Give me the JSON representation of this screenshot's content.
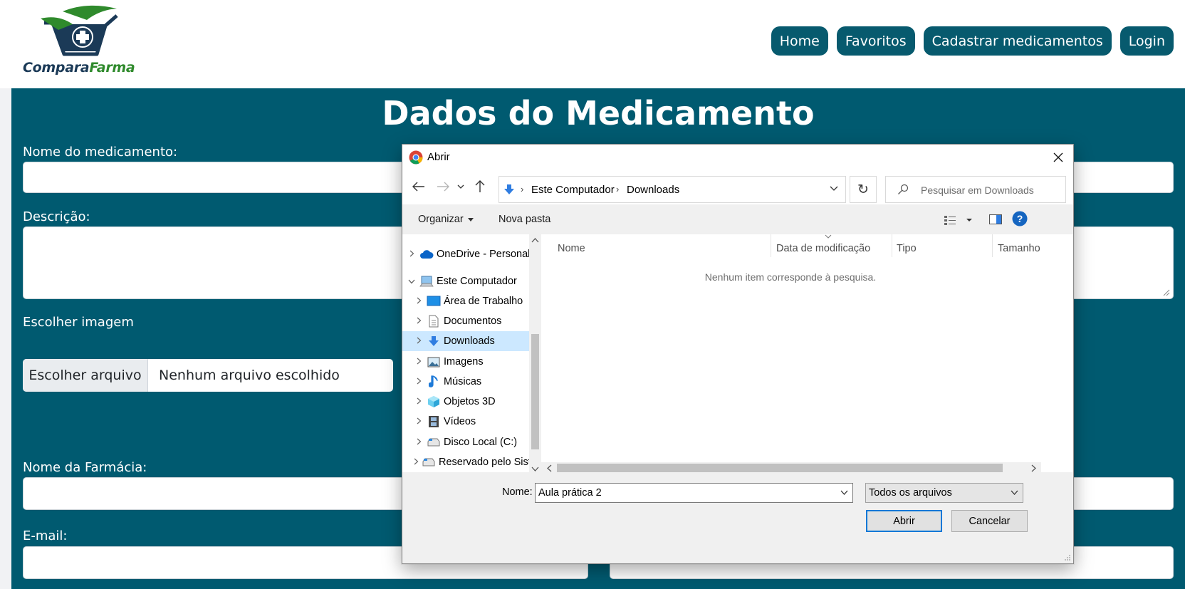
{
  "header": {
    "logo": {
      "part1": "Compara",
      "part2": "Farma"
    },
    "nav": [
      "Home",
      "Favoritos",
      "Cadastrar medicamentos",
      "Login"
    ]
  },
  "form": {
    "title": "Dados do Medicamento",
    "labels": {
      "nome": "Nome do medicamento:",
      "descricao": "Descrição:",
      "imagem": "Escolher imagem",
      "farmacia": "Nome da Farmácia:",
      "email": "E-mail:"
    },
    "file_button": "Escolher arquivo",
    "file_status": "Nenhum arquivo escolhido"
  },
  "dialog": {
    "title": "Abrir",
    "breadcrumb": [
      "Este Computador",
      "Downloads"
    ],
    "search_placeholder": "Pesquisar em Downloads",
    "commands": {
      "organize": "Organizar",
      "new_folder": "Nova pasta"
    },
    "tree": [
      {
        "label": "OneDrive - Personal",
        "icon": "cloud-icon",
        "level": 0,
        "expanded": false
      },
      {
        "label": "Este Computador",
        "icon": "computer-icon",
        "level": 0,
        "expanded": true
      },
      {
        "label": "Área de Trabalho",
        "icon": "desktop-icon",
        "level": 1,
        "expanded": false
      },
      {
        "label": "Documentos",
        "icon": "document-icon",
        "level": 1,
        "expanded": false
      },
      {
        "label": "Downloads",
        "icon": "download-icon",
        "level": 1,
        "expanded": false,
        "selected": true
      },
      {
        "label": "Imagens",
        "icon": "image-icon",
        "level": 1,
        "expanded": false
      },
      {
        "label": "Músicas",
        "icon": "music-icon",
        "level": 1,
        "expanded": false
      },
      {
        "label": "Objetos 3D",
        "icon": "cube-icon",
        "level": 1,
        "expanded": false
      },
      {
        "label": "Vídeos",
        "icon": "video-icon",
        "level": 1,
        "expanded": false
      },
      {
        "label": "Disco Local (C:)",
        "icon": "drive-icon",
        "level": 1,
        "expanded": false
      },
      {
        "label": "Reservado pelo Sistema",
        "icon": "drive-icon",
        "level": 1,
        "expanded": false
      }
    ],
    "columns": [
      "Nome",
      "Data de modificação",
      "Tipo",
      "Tamanho"
    ],
    "empty_message": "Nenhum item corresponde à pesquisa.",
    "filename_label": "Nome:",
    "filename_value": "Aula prática 2",
    "filetype": "Todos os arquivos",
    "buttons": {
      "open": "Abrir",
      "cancel": "Cancelar"
    }
  },
  "colors": {
    "brand_teal": "#005a70",
    "nav_button": "#075a6e",
    "logo_dark": "#1b3a57",
    "logo_green": "#2f8a2c",
    "selection": "#cce8ff",
    "focus_blue": "#0078d7"
  }
}
